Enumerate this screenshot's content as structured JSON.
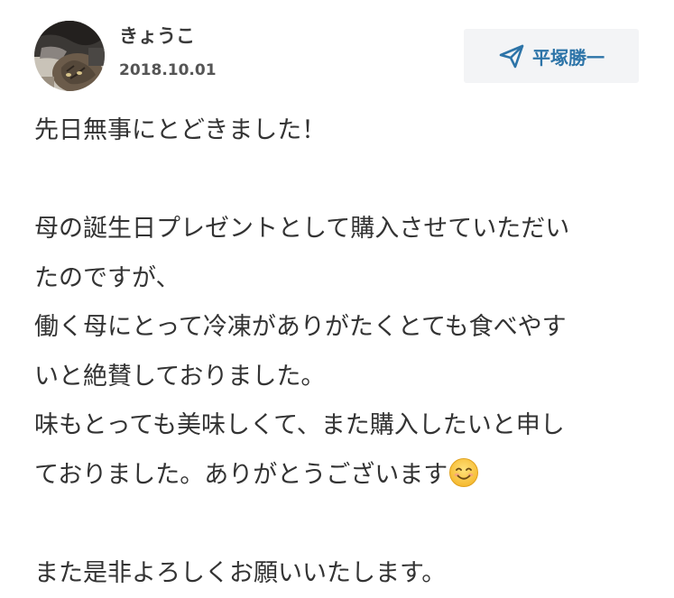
{
  "review": {
    "author": {
      "name": "きょうこ",
      "date": "2018.10.01",
      "avatar_icon": "cat-photo-avatar"
    },
    "recipient": {
      "label": "平塚勝一",
      "icon": "send-icon",
      "color": "#2d74a8"
    },
    "message_lines": [
      "先日無事にとどきました！",
      "",
      "母の誕生日プレゼントとして購入させていただい",
      "たのですが、",
      "働く母にとって冷凍がありがたくとても食べやす",
      "いと絶賛しておりました。",
      "味もとっても美味しくて、また購入したいと申し",
      "ておりました。ありがとうございます",
      "",
      "また是非よろしくお願いいたします。"
    ],
    "emoji": "smiling-face-icon"
  }
}
